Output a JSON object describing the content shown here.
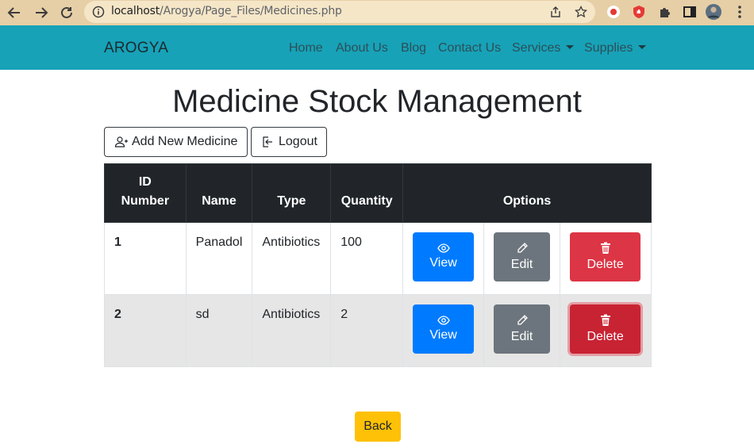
{
  "browser": {
    "url_host": "localhost",
    "url_path": "/Arogya/Page_Files/Medicines.php"
  },
  "navbar": {
    "brand": "AROGYA",
    "links": [
      "Home",
      "About Us",
      "Blog",
      "Contact Us"
    ],
    "dropdowns": [
      "Services",
      "Supplies"
    ]
  },
  "page": {
    "title": "Medicine Stock Management",
    "add_label": "Add New Medicine",
    "logout_label": "Logout",
    "back_label": "Back"
  },
  "table": {
    "headers": {
      "id_line1": "ID",
      "id_line2": "Number",
      "name": "Name",
      "type": "Type",
      "quantity": "Quantity",
      "options": "Options"
    },
    "rows": [
      {
        "id": "1",
        "name": "Panadol",
        "type": "Antibiotics",
        "quantity": "100"
      },
      {
        "id": "2",
        "name": "sd",
        "type": "Antibiotics",
        "quantity": "2"
      }
    ],
    "view_label": "View",
    "edit_label": "Edit",
    "delete_label": "Delete"
  },
  "colors": {
    "navbar": "#17a2b8",
    "view": "#007bff",
    "edit": "#6c757d",
    "delete": "#dc3545",
    "back": "#ffc107"
  }
}
